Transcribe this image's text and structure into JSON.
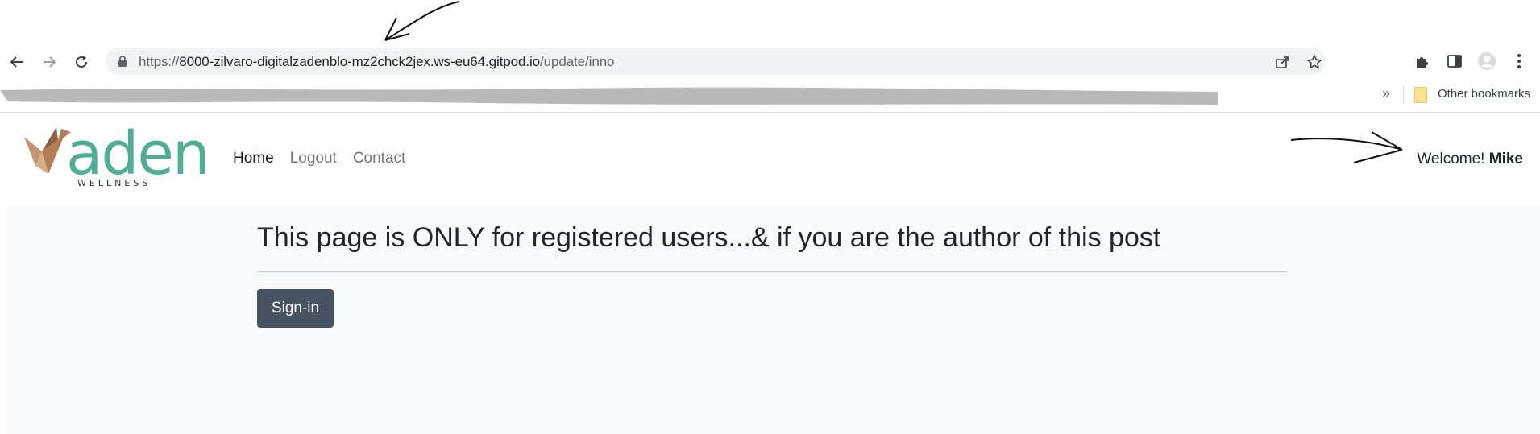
{
  "browser": {
    "url_scheme": "https://",
    "url_host": "8000-zilvaro-digitalzadenblo-mz2chck2jex.ws-eu64.gitpod.io",
    "url_path": "/update/inno",
    "bookmarks_overflow": "»",
    "other_bookmarks_label": "Other bookmarks"
  },
  "site": {
    "brand": "aden",
    "brand_sub": "WELLNESS",
    "nav": [
      {
        "label": "Home"
      },
      {
        "label": "Logout"
      },
      {
        "label": "Contact"
      }
    ],
    "welcome_prefix": "Welcome!",
    "user_name": "Mike",
    "brand_color": "#4fae95"
  },
  "main": {
    "heading": "This page is ONLY for registered users...& if you are the author of this post",
    "signin_label": "Sign-in"
  },
  "icons": [
    "arrow-left-icon",
    "arrow-right-icon",
    "reload-icon",
    "lock-icon",
    "share-icon",
    "star-icon",
    "puzzle-icon",
    "side-panel-icon",
    "profile-icon",
    "kebab-menu-icon",
    "folder-icon",
    "origami-bird-logo-icon"
  ]
}
